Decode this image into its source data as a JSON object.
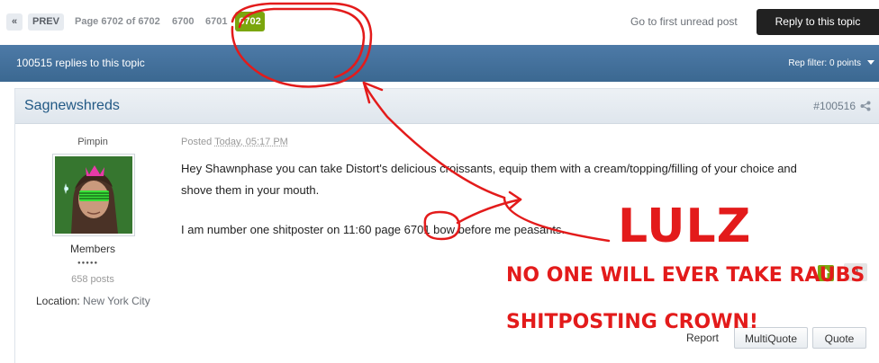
{
  "pager": {
    "first_label": "«",
    "prev_label": "PREV",
    "page_info": "Page 6702 of 6702",
    "page_6700": "6700",
    "page_6701": "6701",
    "page_current": "6702"
  },
  "toolbar": {
    "first_unread_label": "Go to first unread post",
    "reply_label": "Reply to this topic"
  },
  "topic_bar": {
    "replies": "100515 replies to this topic",
    "rep_filter": "Rep filter: 0 points"
  },
  "post": {
    "author": "Sagnewshreds",
    "number": "#100516",
    "rank": "Pimpin",
    "group": "Members",
    "pips": "●●●●●",
    "posts": "658 posts",
    "location_label": "Location: ",
    "location_value": "New York City",
    "posted_label": "Posted ",
    "posted_time": "Today, 05:17 PM",
    "line1": "Hey Shawnphase you can take Distort's delicious croissants, equip them with a cream/topping/filling of your choice and",
    "line2": "shove them in your mouth.",
    "line3": "I am number one shitposter on 11:60 page 6701 bow before me peasants.",
    "rep_value": "0",
    "report_label": "Report",
    "multiquote_label": "MultiQuote",
    "quote_label": "Quote"
  },
  "annotation": {
    "lulz": "LULZ",
    "line1": "NO ONE WILL EVER TAKE RAUBS",
    "line2": "SHITPOSTING CROWN!",
    "color": "#e31b1b"
  },
  "colors": {
    "accent_green": "#7ba60d",
    "topic_bar_blue": "#3b6891",
    "link_blue": "#225985"
  }
}
